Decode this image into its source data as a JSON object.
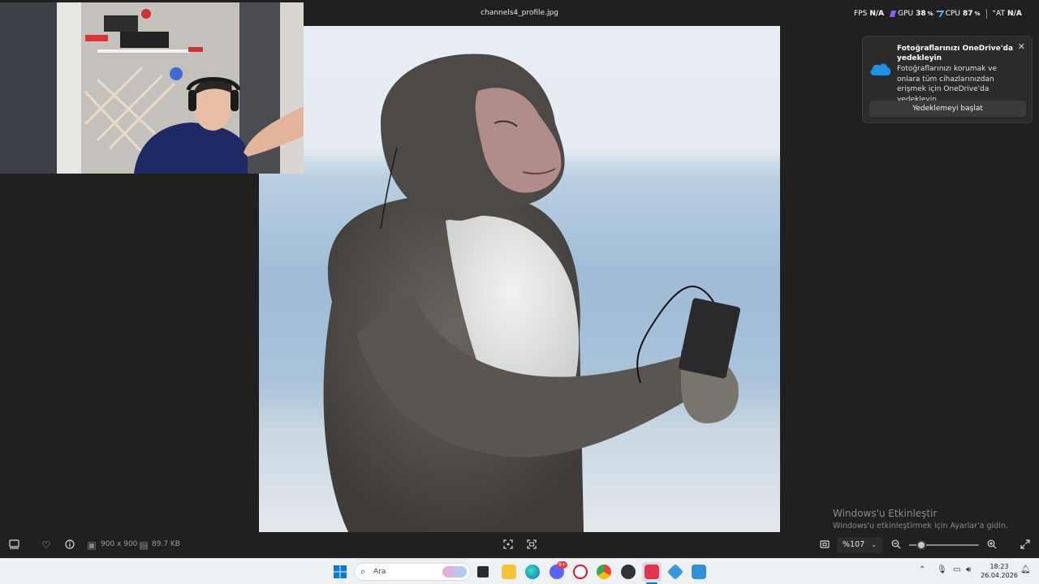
{
  "window": {
    "title": "channels4_profile.jpg"
  },
  "overlay": {
    "fps_label": "FPS",
    "fps_value": "N/A",
    "gpu_label": "GPU",
    "gpu_value": "38",
    "gpu_unit": "%",
    "cpu_label": "CPU",
    "cpu_value": "87",
    "cpu_unit": "%",
    "temp_label": "°AT",
    "temp_value": "N/A"
  },
  "notification": {
    "title": "Fotoğraflarınızı OneDrive'da yedekleyin",
    "body": "Fotoğraflarınızı korumak ve onlara tüm cihazlarınızdan erişmek için OneDrive'da yedekleyin.",
    "button": "Yedeklemeyi başlat",
    "close_icon": "close-icon",
    "app_icon": "onedrive-cloud-icon"
  },
  "watermark": {
    "title": "Windows'u Etkinleştir",
    "subtitle": "Windows'u etkinleştirmek için Ayarlar'a gidin."
  },
  "viewer_bar": {
    "dimensions": "900 x 900",
    "file_size": "89.7 KB",
    "zoom": "%107"
  },
  "taskbar": {
    "search_placeholder": "Ara",
    "time": "18:23",
    "date": "26.04.2026",
    "chat_badge": "9+"
  },
  "colors": {
    "background": "#202020",
    "toast_bg": "#2b2b2b",
    "taskbar_bg": "#eef1f4",
    "onedrive_blue": "#1e90e8",
    "gpu_purple": "#8a5cf6"
  }
}
